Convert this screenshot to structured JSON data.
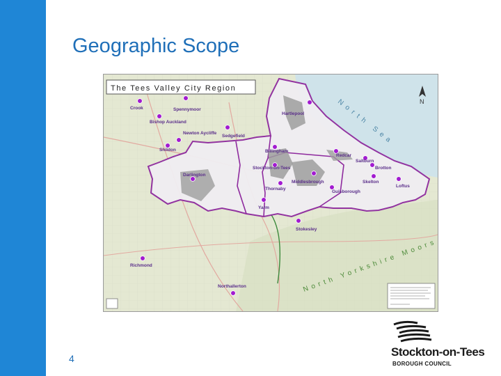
{
  "slide": {
    "title": "Geographic Scope",
    "page_number": "4"
  },
  "map": {
    "title": "The Tees Valley City Region",
    "north_label": "N",
    "sea_label": "North Sea",
    "moors_label": "North Yorkshire Moors",
    "towns": [
      {
        "name": "Crook"
      },
      {
        "name": "Spennymoor"
      },
      {
        "name": "Bishop Auckland"
      },
      {
        "name": "Newton Aycliffe"
      },
      {
        "name": "Sedgefield"
      },
      {
        "name": "Shildon"
      },
      {
        "name": "Hartlepool"
      },
      {
        "name": "Billingham"
      },
      {
        "name": "Redcar"
      },
      {
        "name": "Saltburn"
      },
      {
        "name": "Brotton"
      },
      {
        "name": "Stockton-on-Tees"
      },
      {
        "name": "Middlesbrough"
      },
      {
        "name": "Skelton"
      },
      {
        "name": "Loftus"
      },
      {
        "name": "Darlington"
      },
      {
        "name": "Thornaby"
      },
      {
        "name": "Guisborough"
      },
      {
        "name": "Yarm"
      },
      {
        "name": "Stokesley"
      },
      {
        "name": "Richmond"
      },
      {
        "name": "Northallerton"
      }
    ],
    "colors": {
      "boundary": "#8e2a9e",
      "town_marker": "#a21bd0",
      "sea": "#cfe3ea",
      "land": "#e4e8d2",
      "urban": "#9d9d9d",
      "region_fill": "#f0eef2"
    }
  },
  "logo": {
    "name": "Stockton-on-Tees",
    "subtitle": "BOROUGH COUNCIL"
  },
  "colors": {
    "accent_bar": "#1f86d6",
    "title": "#1f6fb8"
  }
}
